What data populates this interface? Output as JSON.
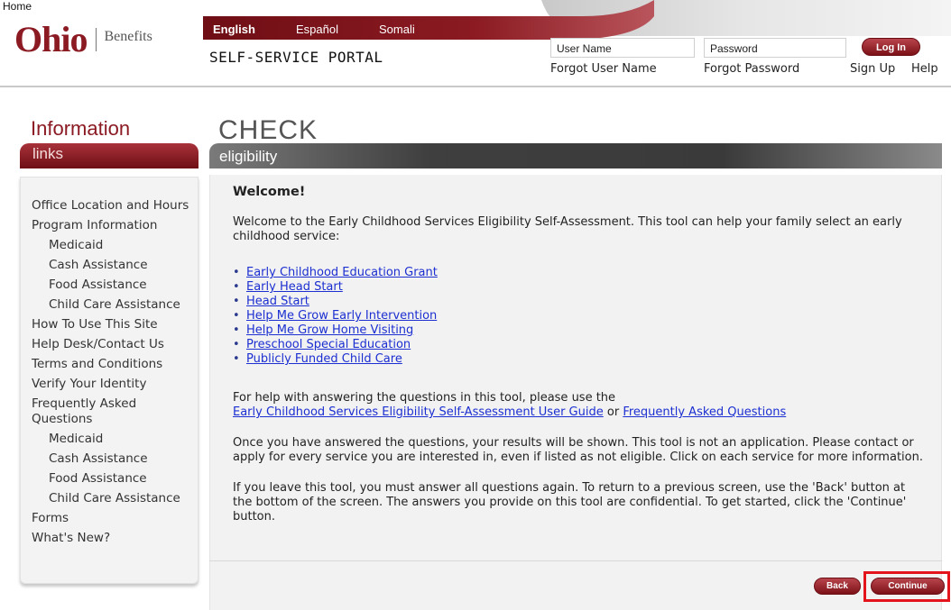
{
  "header": {
    "home_link": "Home",
    "logo": {
      "primary": "Ohio",
      "secondary": "Benefits"
    },
    "portal_title": "SELF-SERVICE PORTAL",
    "languages": [
      "English",
      "Español",
      "Somali"
    ],
    "login": {
      "username_placeholder": "User Name",
      "password_placeholder": "Password",
      "login_label": "Log In",
      "forgot_username": "Forgot User Name",
      "forgot_password": "Forgot Password",
      "sign_up": "Sign Up",
      "help": "Help"
    },
    "colors": {
      "brand": "#8b1a22",
      "band": "#7d1118"
    }
  },
  "sidebar": {
    "heading": "Information",
    "tab_label": "links",
    "items": [
      {
        "label": "Office Location and Hours",
        "level": 0
      },
      {
        "label": "Program Information",
        "level": 0
      },
      {
        "label": "Medicaid",
        "level": 1
      },
      {
        "label": "Cash Assistance",
        "level": 1
      },
      {
        "label": "Food Assistance",
        "level": 1
      },
      {
        "label": "Child Care Assistance",
        "level": 1
      },
      {
        "label": "How To Use This Site",
        "level": 0
      },
      {
        "label": "Help Desk/Contact Us",
        "level": 0
      },
      {
        "label": "Terms and Conditions",
        "level": 0
      },
      {
        "label": "Verify Your Identity",
        "level": 0
      },
      {
        "label": "Frequently Asked Questions",
        "level": 0
      },
      {
        "label": "Medicaid",
        "level": 1
      },
      {
        "label": "Cash Assistance",
        "level": 1
      },
      {
        "label": "Food Assistance",
        "level": 1
      },
      {
        "label": "Child Care Assistance",
        "level": 1
      },
      {
        "label": "Forms",
        "level": 0
      },
      {
        "label": "What's New?",
        "level": 0
      }
    ]
  },
  "main": {
    "title": "CHECK",
    "tab_label": "eligibility",
    "welcome_heading": "Welcome!",
    "intro": "Welcome to the Early Childhood Services Eligibility Self-Assessment. This tool can help your family select an early childhood service:",
    "services": [
      "Early Childhood Education Grant",
      "Early Head Start",
      "Head Start",
      "Help Me Grow Early Intervention",
      "Help Me Grow Home Visiting",
      "Preschool Special Education",
      "Publicly Funded Child Care"
    ],
    "help_prefix": "For help with answering the questions in this tool, please use the",
    "user_guide_link": "Early Childhood Services Eligibility Self-Assessment User Guide",
    "or_text": "or",
    "faq_link": "Frequently Asked Questions",
    "results_paragraph": "Once you have answered the questions, your results will be shown. This tool is not an application. Please contact or apply for every service you are interested in, even if listed as not eligible. Click on each service for more information.",
    "leave_paragraph": "If you leave this tool, you must answer all questions again. To return to a previous screen, use the 'Back' button at the bottom of the screen. The answers you provide on this tool are confidential. To get started, click the 'Continue' button.",
    "back_label": "Back",
    "continue_label": "Continue",
    "highlight_color": "#e3141b"
  }
}
